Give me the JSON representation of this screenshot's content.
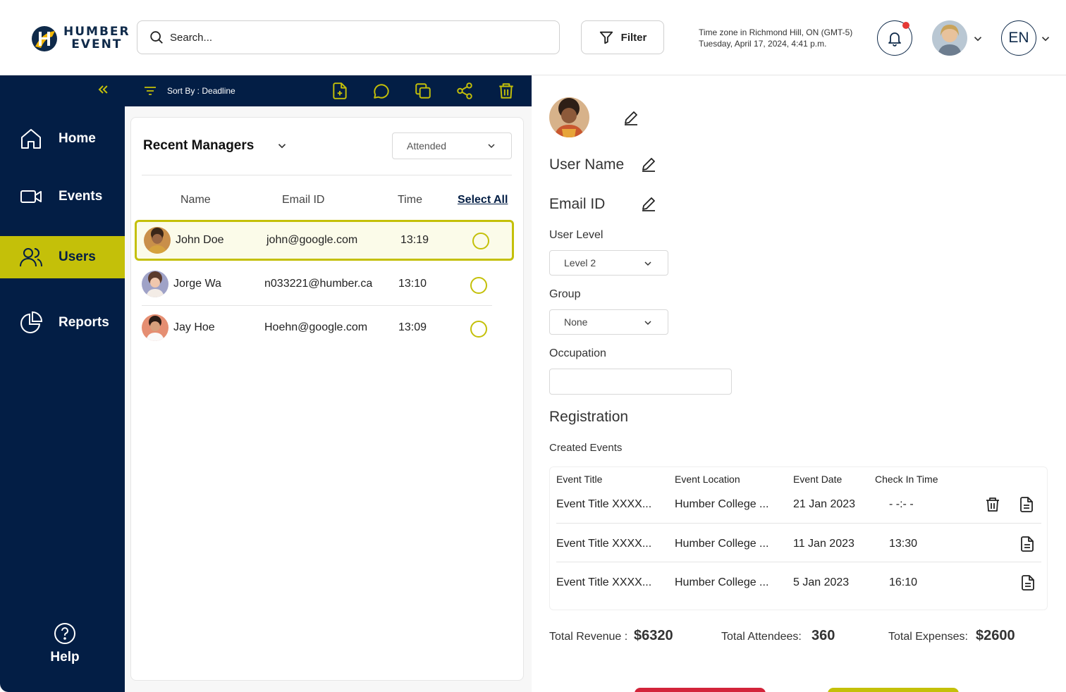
{
  "header": {
    "logo_line1": "HUMBER",
    "logo_line2": "EVENT",
    "search_placeholder": "Search...",
    "filter_label": "Filter",
    "timezone": "Time zone in Richmond Hill, ON (GMT-5)",
    "datetime": "Tuesday, April 17, 2024, 4:41 p.m.",
    "language": "EN"
  },
  "sidebar": {
    "items": [
      {
        "label": "Home",
        "icon": "home-icon"
      },
      {
        "label": "Events",
        "icon": "video-icon"
      },
      {
        "label": "Users",
        "icon": "users-icon",
        "active": true
      },
      {
        "label": "Reports",
        "icon": "pie-chart-icon"
      }
    ],
    "help_label": "Help"
  },
  "toolbar": {
    "sort_label": "Sort By : Deadline",
    "tools": [
      "add-file-icon",
      "comment-icon",
      "copy-icon",
      "share-icon",
      "trash-icon"
    ]
  },
  "managers": {
    "title": "Recent Managers",
    "filter_value": "Attended",
    "columns": {
      "name": "Name",
      "email": "Email ID",
      "time": "Time",
      "select_all": "Select All"
    },
    "rows": [
      {
        "name": "John Doe",
        "email": "john@google.com",
        "time": "13:19",
        "selected": true
      },
      {
        "name": "Jorge Wa",
        "email": "n033221@humber.ca",
        "time": "13:10",
        "selected": false
      },
      {
        "name": "Jay Hoe",
        "email": "Hoehn@google.com",
        "time": "13:09",
        "selected": false
      }
    ]
  },
  "detail": {
    "user_name_label": "User Name",
    "email_label": "Email ID",
    "user_level_label": "User Level",
    "user_level_value": "Level 2",
    "group_label": "Group",
    "group_value": "None",
    "occupation_label": "Occupation",
    "occupation_value": "",
    "registration_title": "Registration",
    "created_events_label": "Created Events",
    "events_columns": {
      "title": "Event Title",
      "location": "Event Location",
      "date": "Event Date",
      "checkin": "Check In Time"
    },
    "events": [
      {
        "title": "Event Title XXXX...",
        "location": "Humber College ...",
        "date": "21 Jan 2023",
        "checkin": "- -:- -"
      },
      {
        "title": "Event Title XXXX...",
        "location": "Humber College ...",
        "date": "11 Jan 2023",
        "checkin": "13:30"
      },
      {
        "title": "Event Title XXXX...",
        "location": "Humber College ...",
        "date": "5 Jan 2023",
        "checkin": "16:10"
      }
    ],
    "totals": {
      "revenue_label": "Total Revenue :",
      "revenue_value": "$6320",
      "attendees_label": "Total Attendees:",
      "attendees_value": "360",
      "expenses_label": "Total Expenses:",
      "expenses_value": "$2600"
    }
  },
  "colors": {
    "navy": "#031e45",
    "accent": "#c4c009",
    "danger": "#d3243a",
    "notification": "#e53935"
  }
}
